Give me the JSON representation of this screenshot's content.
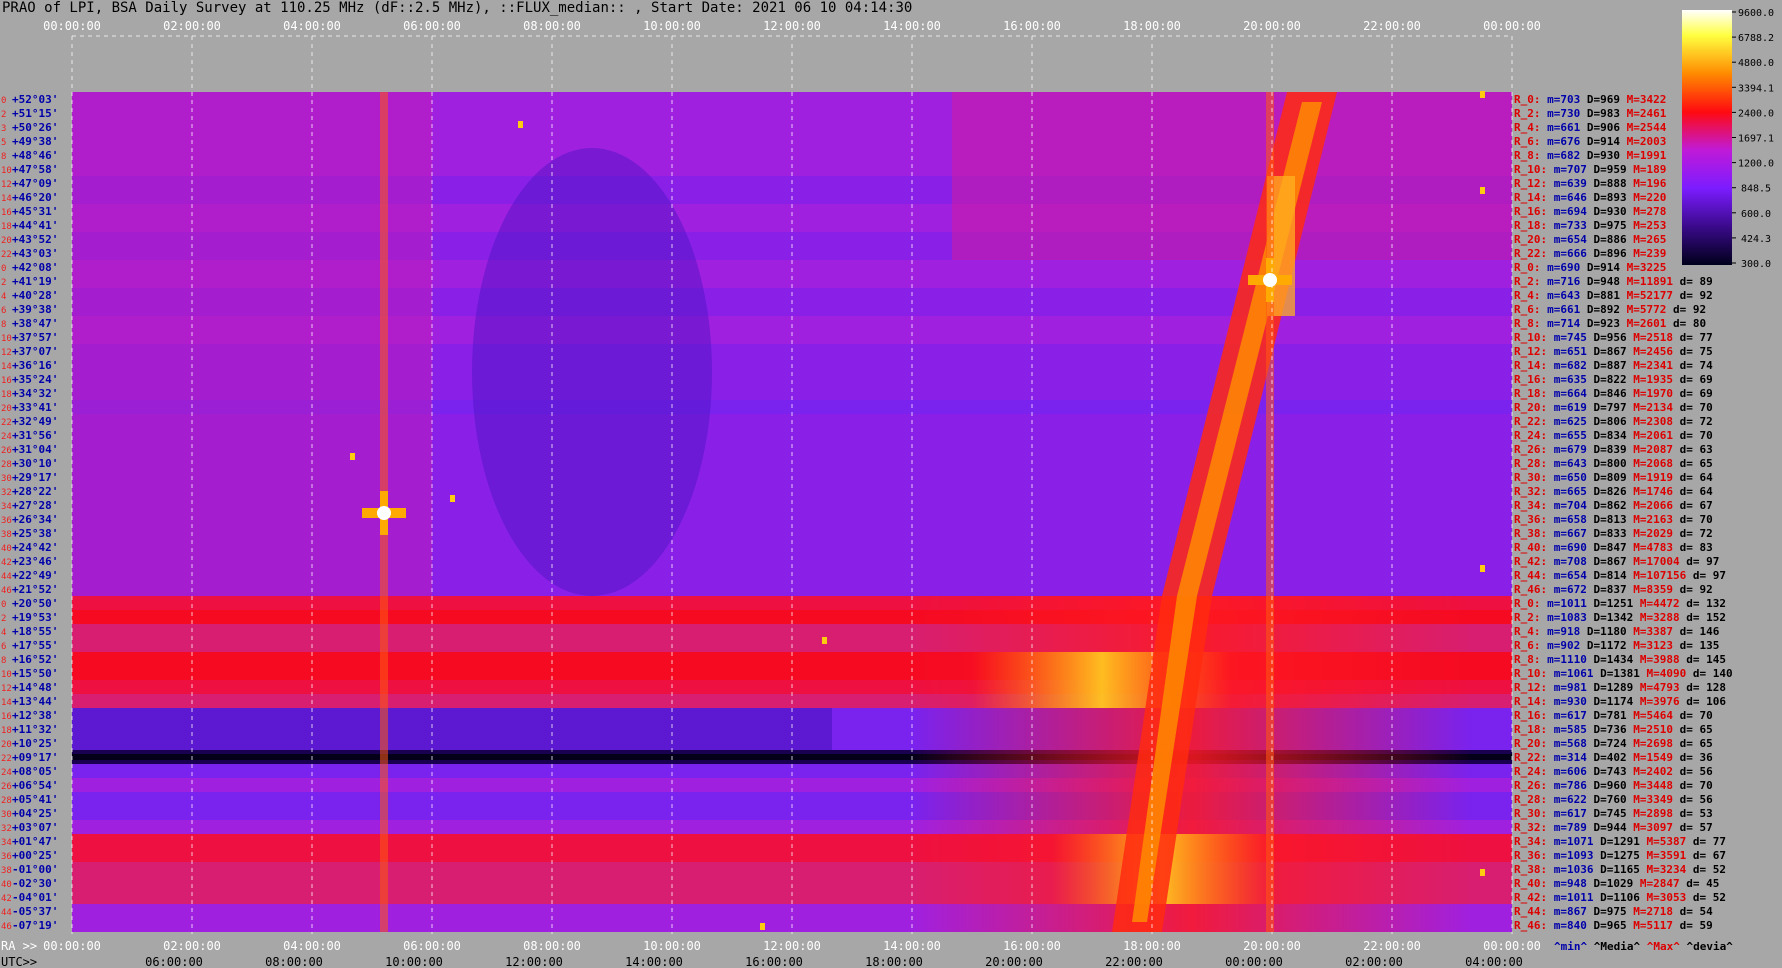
{
  "header": {
    "title": "PRAO of LPI, BSA Daily Survey at 110.25 MHz (dF::2.5 MHz), ::FLUX_median:: , Start Date: 2021 06 10 04:14:30"
  },
  "chart_data": {
    "type": "heatmap",
    "title": "PRAO of LPI, BSA Daily Survey at 110.25 MHz (dF::2.5 MHz), ::FLUX_median:: , Start Date: 2021 06 10 04:14:30",
    "top_time_ticks": [
      "00:00:00",
      "02:00:00",
      "04:00:00",
      "06:00:00",
      "08:00:00",
      "10:00:00",
      "12:00:00",
      "14:00:00",
      "16:00:00",
      "18:00:00",
      "20:00:00",
      "22:00:00",
      "00:00:00"
    ],
    "bottom_ra_prefix": "RA >>",
    "bottom_ra_ticks": [
      "00:00:00",
      "02:00:00",
      "04:00:00",
      "06:00:00",
      "08:00:00",
      "10:00:00",
      "12:00:00",
      "14:00:00",
      "16:00:00",
      "18:00:00",
      "20:00:00",
      "22:00:00",
      "00:00:00"
    ],
    "bottom_utc_prefix": "UTC>>",
    "bottom_utc_ticks": [
      "06:00:00",
      "08:00:00",
      "10:00:00",
      "12:00:00",
      "14:00:00",
      "16:00:00",
      "18:00:00",
      "20:00:00",
      "22:00:00",
      "00:00:00",
      "02:00:00",
      "04:00:00"
    ],
    "colorbar": {
      "ticks": [
        "9600.0",
        "6788.2",
        "4800.0",
        "3394.1",
        "2400.0",
        "1697.1",
        "1200.0",
        "848.5",
        "600.0",
        "424.3",
        "300.0"
      ]
    },
    "legend_bottom": {
      "min": "^min^",
      "median": "^Media^",
      "max": "^Max^",
      "devia": "^devia^"
    },
    "rows": [
      {
        "n": "0",
        "dec": "+52°03'",
        "r": "R_0:",
        "m": "m=703",
        "d": "D=969",
        "M": "M=3422",
        "dv": ""
      },
      {
        "n": "2",
        "dec": "+51°15'",
        "r": "R_2:",
        "m": "m=730",
        "d": "D=983",
        "M": "M=2461",
        "dv": ""
      },
      {
        "n": "3",
        "dec": "+50°26'",
        "r": "R_4:",
        "m": "m=661",
        "d": "D=906",
        "M": "M=2544",
        "dv": ""
      },
      {
        "n": "5",
        "dec": "+49°38'",
        "r": "R_6:",
        "m": "m=676",
        "d": "D=914",
        "M": "M=2003",
        "dv": ""
      },
      {
        "n": "8",
        "dec": "+48°46'",
        "r": "R_8:",
        "m": "m=682",
        "d": "D=930",
        "M": "M=1991",
        "dv": ""
      },
      {
        "n": "10",
        "dec": "+47°58'",
        "r": "R_10:",
        "m": "m=707",
        "d": "D=959",
        "M": "M=189",
        "dv": ""
      },
      {
        "n": "12",
        "dec": "+47°09'",
        "r": "R_12:",
        "m": "m=639",
        "d": "D=888",
        "M": "M=196",
        "dv": ""
      },
      {
        "n": "14",
        "dec": "+46°20'",
        "r": "R_14:",
        "m": "m=646",
        "d": "D=893",
        "M": "M=220",
        "dv": ""
      },
      {
        "n": "16",
        "dec": "+45°31'",
        "r": "R_16:",
        "m": "m=694",
        "d": "D=930",
        "M": "M=278",
        "dv": ""
      },
      {
        "n": "18",
        "dec": "+44°41'",
        "r": "R_18:",
        "m": "m=733",
        "d": "D=975",
        "M": "M=253",
        "dv": ""
      },
      {
        "n": "20",
        "dec": "+43°52'",
        "r": "R_20:",
        "m": "m=654",
        "d": "D=886",
        "M": "M=265",
        "dv": ""
      },
      {
        "n": "22",
        "dec": "+43°03'",
        "r": "R_22:",
        "m": "m=666",
        "d": "D=896",
        "M": "M=239",
        "dv": ""
      },
      {
        "n": "0",
        "dec": "+42°08'",
        "r": "R_0:",
        "m": "m=690",
        "d": "D=914",
        "M": "M=3225",
        "dv": ""
      },
      {
        "n": "2",
        "dec": "+41°19'",
        "r": "R_2:",
        "m": "m=716",
        "d": "D=948",
        "M": "M=11891",
        "dv": "d= 89"
      },
      {
        "n": "4",
        "dec": "+40°28'",
        "r": "R_4:",
        "m": "m=643",
        "d": "D=881",
        "M": "M=52177",
        "dv": "d= 92"
      },
      {
        "n": "6",
        "dec": "+39°38'",
        "r": "R_6:",
        "m": "m=661",
        "d": "D=892",
        "M": "M=5772",
        "dv": "d= 92"
      },
      {
        "n": "8",
        "dec": "+38°47'",
        "r": "R_8:",
        "m": "m=714",
        "d": "D=923",
        "M": "M=2601",
        "dv": "d= 80"
      },
      {
        "n": "10",
        "dec": "+37°57'",
        "r": "R_10:",
        "m": "m=745",
        "d": "D=956",
        "M": "M=2518",
        "dv": "d= 77"
      },
      {
        "n": "12",
        "dec": "+37°07'",
        "r": "R_12:",
        "m": "m=651",
        "d": "D=867",
        "M": "M=2456",
        "dv": "d= 75"
      },
      {
        "n": "14",
        "dec": "+36°16'",
        "r": "R_14:",
        "m": "m=682",
        "d": "D=887",
        "M": "M=2341",
        "dv": "d= 74"
      },
      {
        "n": "16",
        "dec": "+35°24'",
        "r": "R_16:",
        "m": "m=635",
        "d": "D=822",
        "M": "M=1935",
        "dv": "d= 69"
      },
      {
        "n": "18",
        "dec": "+34°32'",
        "r": "R_18:",
        "m": "m=664",
        "d": "D=846",
        "M": "M=1970",
        "dv": "d= 69"
      },
      {
        "n": "20",
        "dec": "+33°41'",
        "r": "R_20:",
        "m": "m=619",
        "d": "D=797",
        "M": "M=2134",
        "dv": "d= 70"
      },
      {
        "n": "22",
        "dec": "+32°49'",
        "r": "R_22:",
        "m": "m=625",
        "d": "D=806",
        "M": "M=2308",
        "dv": "d= 72"
      },
      {
        "n": "24",
        "dec": "+31°56'",
        "r": "R_24:",
        "m": "m=655",
        "d": "D=834",
        "M": "M=2061",
        "dv": "d= 70"
      },
      {
        "n": "26",
        "dec": "+31°04'",
        "r": "R_26:",
        "m": "m=679",
        "d": "D=839",
        "M": "M=2087",
        "dv": "d= 63"
      },
      {
        "n": "28",
        "dec": "+30°10'",
        "r": "R_28:",
        "m": "m=643",
        "d": "D=800",
        "M": "M=2068",
        "dv": "d= 65"
      },
      {
        "n": "30",
        "dec": "+29°17'",
        "r": "R_30:",
        "m": "m=650",
        "d": "D=809",
        "M": "M=1919",
        "dv": "d= 64"
      },
      {
        "n": "32",
        "dec": "+28°22'",
        "r": "R_32:",
        "m": "m=665",
        "d": "D=826",
        "M": "M=1746",
        "dv": "d= 64"
      },
      {
        "n": "34",
        "dec": "+27°28'",
        "r": "R_34:",
        "m": "m=704",
        "d": "D=862",
        "M": "M=2066",
        "dv": "d= 67"
      },
      {
        "n": "36",
        "dec": "+26°34'",
        "r": "R_36:",
        "m": "m=658",
        "d": "D=813",
        "M": "M=2163",
        "dv": "d= 70"
      },
      {
        "n": "38",
        "dec": "+25°38'",
        "r": "R_38:",
        "m": "m=667",
        "d": "D=833",
        "M": "M=2029",
        "dv": "d= 72"
      },
      {
        "n": "40",
        "dec": "+24°42'",
        "r": "R_40:",
        "m": "m=690",
        "d": "D=847",
        "M": "M=4783",
        "dv": "d= 83"
      },
      {
        "n": "42",
        "dec": "+23°46'",
        "r": "R_42:",
        "m": "m=708",
        "d": "D=867",
        "M": "M=17004",
        "dv": "d= 97"
      },
      {
        "n": "44",
        "dec": "+22°49'",
        "r": "R_44:",
        "m": "m=654",
        "d": "D=814",
        "M": "M=107156",
        "dv": "d= 97"
      },
      {
        "n": "46",
        "dec": "+21°52'",
        "r": "R_46:",
        "m": "m=672",
        "d": "D=837",
        "M": "M=8359",
        "dv": "d= 92"
      },
      {
        "n": "0",
        "dec": "+20°50'",
        "r": "R_0:",
        "m": "m=1011",
        "d": "D=1251",
        "M": "M=4472",
        "dv": "d= 132"
      },
      {
        "n": "2",
        "dec": "+19°53'",
        "r": "R_2:",
        "m": "m=1083",
        "d": "D=1342",
        "M": "M=3288",
        "dv": "d= 152"
      },
      {
        "n": "4",
        "dec": "+18°55'",
        "r": "R_4:",
        "m": "m=918",
        "d": "D=1180",
        "M": "M=3387",
        "dv": "d= 146"
      },
      {
        "n": "6",
        "dec": "+17°55'",
        "r": "R_6:",
        "m": "m=902",
        "d": "D=1172",
        "M": "M=3123",
        "dv": "d= 135"
      },
      {
        "n": "8",
        "dec": "+16°52'",
        "r": "R_8:",
        "m": "m=1110",
        "d": "D=1434",
        "M": "M=3988",
        "dv": "d= 145"
      },
      {
        "n": "10",
        "dec": "+15°50'",
        "r": "R_10:",
        "m": "m=1061",
        "d": "D=1381",
        "M": "M=4090",
        "dv": "d= 140"
      },
      {
        "n": "12",
        "dec": "+14°48'",
        "r": "R_12:",
        "m": "m=981",
        "d": "D=1289",
        "M": "M=4793",
        "dv": "d= 128"
      },
      {
        "n": "14",
        "dec": "+13°44'",
        "r": "R_14:",
        "m": "m=930",
        "d": "D=1174",
        "M": "M=3976",
        "dv": "d= 106"
      },
      {
        "n": "16",
        "dec": "+12°38'",
        "r": "R_16:",
        "m": "m=617",
        "d": "D=781",
        "M": "M=5464",
        "dv": "d= 70"
      },
      {
        "n": "18",
        "dec": "+11°32'",
        "r": "R_18:",
        "m": "m=585",
        "d": "D=736",
        "M": "M=2510",
        "dv": "d= 65"
      },
      {
        "n": "20",
        "dec": "+10°25'",
        "r": "R_20:",
        "m": "m=568",
        "d": "D=724",
        "M": "M=2698",
        "dv": "d= 65"
      },
      {
        "n": "22",
        "dec": "+09°17'",
        "r": "R_22:",
        "m": "m=314",
        "d": "D=402",
        "M": "M=1549",
        "dv": "d= 36"
      },
      {
        "n": "24",
        "dec": "+08°05'",
        "r": "R_24:",
        "m": "m=606",
        "d": "D=743",
        "M": "M=2402",
        "dv": "d= 56"
      },
      {
        "n": "26",
        "dec": "+06°54'",
        "r": "R_26:",
        "m": "m=786",
        "d": "D=960",
        "M": "M=3448",
        "dv": "d= 70"
      },
      {
        "n": "28",
        "dec": "+05°41'",
        "r": "R_28:",
        "m": "m=622",
        "d": "D=760",
        "M": "M=3349",
        "dv": "d= 56"
      },
      {
        "n": "30",
        "dec": "+04°25'",
        "r": "R_30:",
        "m": "m=617",
        "d": "D=745",
        "M": "M=2898",
        "dv": "d= 53"
      },
      {
        "n": "32",
        "dec": "+03°07'",
        "r": "R_32:",
        "m": "m=789",
        "d": "D=944",
        "M": "M=3097",
        "dv": "d= 57"
      },
      {
        "n": "34",
        "dec": "+01°47'",
        "r": "R_34:",
        "m": "m=1071",
        "d": "D=1291",
        "M": "M=5387",
        "dv": "d= 77"
      },
      {
        "n": "36",
        "dec": "+00°25'",
        "r": "R_36:",
        "m": "m=1093",
        "d": "D=1275",
        "M": "M=3591",
        "dv": "d= 67"
      },
      {
        "n": "38",
        "dec": "-01°00'",
        "r": "R_38:",
        "m": "m=1036",
        "d": "D=1165",
        "M": "M=3234",
        "dv": "d= 52"
      },
      {
        "n": "40",
        "dec": "-02°30'",
        "r": "R_40:",
        "m": "m=948",
        "d": "D=1029",
        "M": "M=2847",
        "dv": "d= 45"
      },
      {
        "n": "42",
        "dec": "-04°01'",
        "r": "R_42:",
        "m": "m=1011",
        "d": "D=1106",
        "M": "M=3053",
        "dv": "d= 52"
      },
      {
        "n": "44",
        "dec": "-05°37'",
        "r": "R_44:",
        "m": "m=867",
        "d": "D=975",
        "M": "M=2718",
        "dv": "d= 54"
      },
      {
        "n": "46",
        "dec": "-07°19'",
        "r": "R_46:",
        "m": "m=840",
        "d": "D=965",
        "M": "M=5117",
        "dv": "d= 59"
      }
    ]
  },
  "colors": {
    "background": "#a7a7a7",
    "low": "#00001a",
    "purple": "#7b1cff",
    "magenta": "#c01ad8",
    "red": "#ff0a10",
    "orange": "#ff8a00",
    "yellow": "#ffff40",
    "white": "#ffffff",
    "label_blue": "#0000aa",
    "label_red": "#dd0000"
  }
}
